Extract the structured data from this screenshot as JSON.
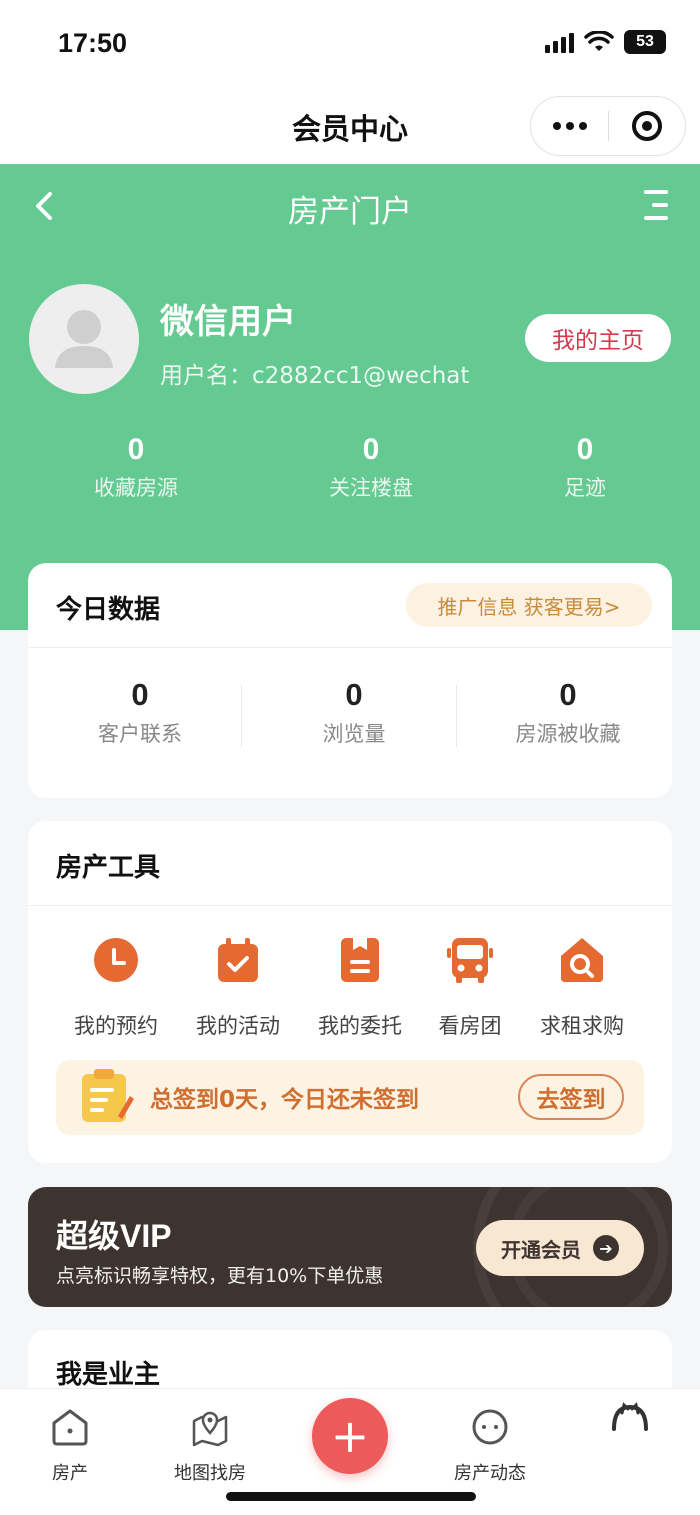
{
  "status_bar": {
    "time": "17:50",
    "battery": "53"
  },
  "mini_program": {
    "title": "会员中心"
  },
  "nav": {
    "title": "房产门户"
  },
  "profile": {
    "name": "微信用户",
    "username": "用户名：c2882cc1@wechat",
    "homepage_label": "我的主页"
  },
  "user_stats": [
    {
      "value": "0",
      "label": "收藏房源"
    },
    {
      "value": "0",
      "label": "关注楼盘"
    },
    {
      "value": "0",
      "label": "足迹"
    }
  ],
  "today": {
    "title": "今日数据",
    "promo": "推广信息 获客更易>",
    "stats": [
      {
        "value": "0",
        "label": "客户联系"
      },
      {
        "value": "0",
        "label": "浏览量"
      },
      {
        "value": "0",
        "label": "房源被收藏"
      }
    ]
  },
  "tools": {
    "title": "房产工具",
    "items": [
      {
        "label": "我的预约",
        "icon": "clock-icon"
      },
      {
        "label": "我的活动",
        "icon": "calendar-check-icon"
      },
      {
        "label": "我的委托",
        "icon": "document-icon"
      },
      {
        "label": "看房团",
        "icon": "bus-icon"
      },
      {
        "label": "求租求购",
        "icon": "house-search-icon"
      }
    ],
    "checkin_text": "总签到0天，今日还未签到",
    "checkin_button": "去签到"
  },
  "vip": {
    "title": "超级VIP",
    "subtitle": "点亮标识畅享特权，更有10%下单优惠",
    "button": "开通会员"
  },
  "owner": {
    "title": "我是业主"
  },
  "tabbar": {
    "items": [
      {
        "label": "房产",
        "icon": "house-icon"
      },
      {
        "label": "地图找房",
        "icon": "map-pin-icon"
      },
      {
        "label": "房产动态",
        "icon": "chat-icon"
      },
      {
        "label": "",
        "icon": "user-icon"
      }
    ],
    "fab": "+"
  },
  "colors": {
    "primary_green": "#65c992",
    "accent_orange": "#e46a32",
    "vip_dark": "#3d332f",
    "fab_red": "#ec5b5a"
  }
}
